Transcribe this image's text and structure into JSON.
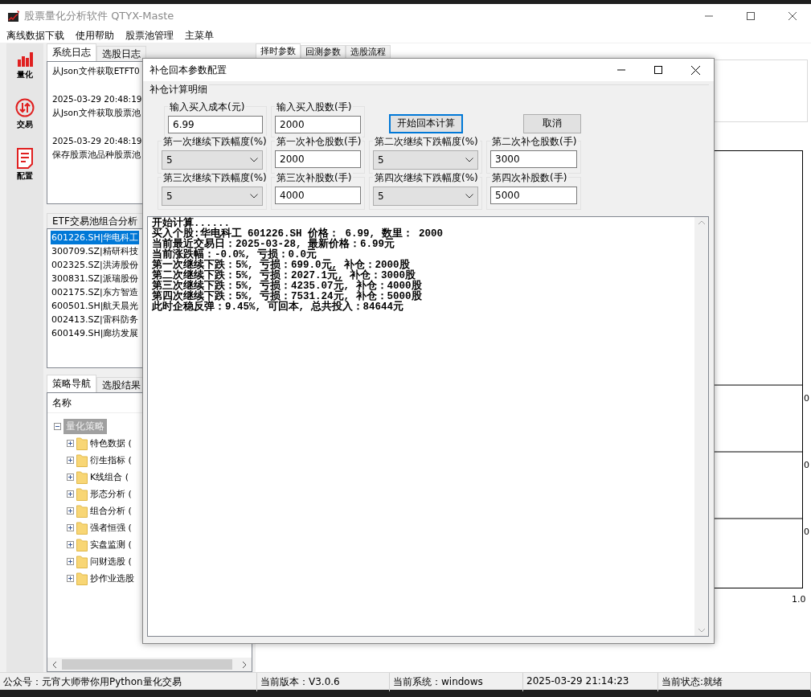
{
  "window": {
    "title": "股票量化分析软件 QTYX-Maste"
  },
  "menu": [
    "离线数据下载",
    "使用帮助",
    "股票池管理",
    "主菜单"
  ],
  "rail": [
    {
      "label": "量化",
      "kind": "chart"
    },
    {
      "label": "交易",
      "kind": "exchange"
    },
    {
      "label": "配置",
      "kind": "document"
    }
  ],
  "log_tabs": [
    {
      "label": "系统日志",
      "selected": true
    },
    {
      "label": "选股日志",
      "selected": false
    }
  ],
  "log_entries": [
    [
      "从Json文件获取ETFT0"
    ],
    [
      "2025-03-29 20:48:19",
      "从Json文件获取股票池"
    ],
    [
      "2025-03-29 20:48:19",
      "保存股票池品种股票池"
    ]
  ],
  "pool_tabs": [
    {
      "label": "ETF交易池组合分析",
      "selected": false
    }
  ],
  "stocks": [
    {
      "label": "601226.SH|华电科工",
      "selected": true
    },
    {
      "label": "300709.SZ|精研科技",
      "selected": false
    },
    {
      "label": "002325.SZ|洪涛股份",
      "selected": false
    },
    {
      "label": "300831.SZ|派瑞股份",
      "selected": false
    },
    {
      "label": "002175.SZ|东方智造",
      "selected": false
    },
    {
      "label": "600501.SH|航天晨光",
      "selected": false
    },
    {
      "label": "002413.SZ|雷科防务",
      "selected": false
    },
    {
      "label": "600149.SH|廊坊发展",
      "selected": false
    }
  ],
  "strategy_tabs": [
    {
      "label": "策略导航",
      "selected": true
    },
    {
      "label": "选股结果",
      "selected": false
    }
  ],
  "tree": {
    "column": "名称",
    "root": {
      "label": "量化策略",
      "expanded": true,
      "selected": true,
      "children": [
        {
          "label": "特色数据 (",
          "expanded": false
        },
        {
          "label": "衍生指标 (",
          "expanded": false
        },
        {
          "label": "K线组合 (",
          "expanded": false
        },
        {
          "label": "形态分析 (",
          "expanded": false
        },
        {
          "label": "组合分析 (",
          "expanded": false
        },
        {
          "label": "强者恒强 (",
          "expanded": false
        },
        {
          "label": "实盘监测 (",
          "expanded": false
        },
        {
          "label": "问财选股 (",
          "expanded": false
        },
        {
          "label": "抄作业选股",
          "expanded": false
        }
      ]
    }
  },
  "right_tabs": [
    {
      "label": "择时参数",
      "selected": true
    },
    {
      "label": "回测参数",
      "selected": false
    },
    {
      "label": "选股流程",
      "selected": false
    }
  ],
  "chart_labels": {
    "rows": [
      "0",
      "0",
      "0"
    ],
    "corner": "1.0"
  },
  "dialog": {
    "title": "补仓回本参数配置",
    "group": "补仓计算明细",
    "top_fields": [
      {
        "label": "输入买入成本(元)",
        "value": "6.99"
      },
      {
        "label": "输入买入股数(手)",
        "value": "2000"
      }
    ],
    "buttons": [
      {
        "label": "开始回本计算",
        "focused": true
      },
      {
        "label": "取消",
        "focused": false
      }
    ],
    "fields": [
      {
        "kind": "select",
        "label": "第一次继续下跌幅度(%)",
        "value": "5"
      },
      {
        "kind": "input",
        "label": "第一次补仓股数(手)",
        "value": "2000"
      },
      {
        "kind": "select",
        "label": "第二次继续下跌幅度(%)",
        "value": "5"
      },
      {
        "kind": "input",
        "label": "第二次补仓股数(手)",
        "value": "3000"
      },
      {
        "kind": "select",
        "label": "第三次继续下跌幅度(%)",
        "value": "5"
      },
      {
        "kind": "input",
        "label": "第三次补股数(手)",
        "value": "4000"
      },
      {
        "kind": "select",
        "label": "第四次继续下跌幅度(%)",
        "value": "5"
      },
      {
        "kind": "input",
        "label": "第四次补股数(手)",
        "value": "5000"
      }
    ],
    "output": [
      "开始计算......",
      "买入个股:华电科工 601226.SH 价格： 6.99, 数里： 2000",
      "当前最近交易日：2025-03-28, 最新价格：6.99元",
      "当前涨跌幅：-0.0%, 亏损：0.0元",
      "第一次继续下跌：5%, 亏损：699.0元, 补仓：2000股",
      "第二次继续下跌：5%, 亏损：2027.1元, 补仓：3000股",
      "第三次继续下跌：5%, 亏损：4235.07元, 补仓：4000股",
      "第四次继续下跌：5%, 亏损：7531.24元, 补仓：5000股",
      "此时企稳反弹：9.45%, 可回本, 总共投入：84644元"
    ]
  },
  "status_bar": [
    "公众号：元宵大师带你用Python量化交易",
    "当前版本：V3.0.6",
    "当前系统：windows",
    "2025-03-29 21:14:23",
    "当前状态:就绪"
  ]
}
